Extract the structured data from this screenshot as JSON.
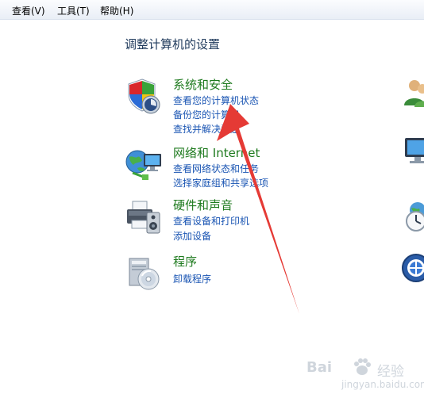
{
  "menubar": {
    "items": [
      "查看(V)",
      "工具(T)",
      "帮助(H)"
    ]
  },
  "page_title": "调整计算机的设置",
  "categories": [
    {
      "title": "系统和安全",
      "icon": "shield-security-icon",
      "links": [
        "查看您的计算机状态",
        "备份您的计算机",
        "查找并解决问题"
      ]
    },
    {
      "title": "网络和 Internet",
      "icon": "network-globe-icon",
      "links": [
        "查看网络状态和任务",
        "选择家庭组和共享选项"
      ]
    },
    {
      "title": "硬件和声音",
      "icon": "printer-speaker-icon",
      "links": [
        "查看设备和打印机",
        "添加设备"
      ]
    },
    {
      "title": "程序",
      "icon": "programs-disc-icon",
      "links": [
        "卸载程序"
      ]
    }
  ],
  "right_column_icons": [
    "user-accounts-icon",
    "appearance-monitor-icon",
    "clock-language-icon",
    "ease-of-access-icon"
  ],
  "watermark": {
    "brand": "Bai",
    "sub": "经验",
    "url": "jingyan.baidu.com"
  },
  "colors": {
    "category_title": "#1e7a1e",
    "link": "#1a55b3",
    "arrow": "#e53a35"
  }
}
